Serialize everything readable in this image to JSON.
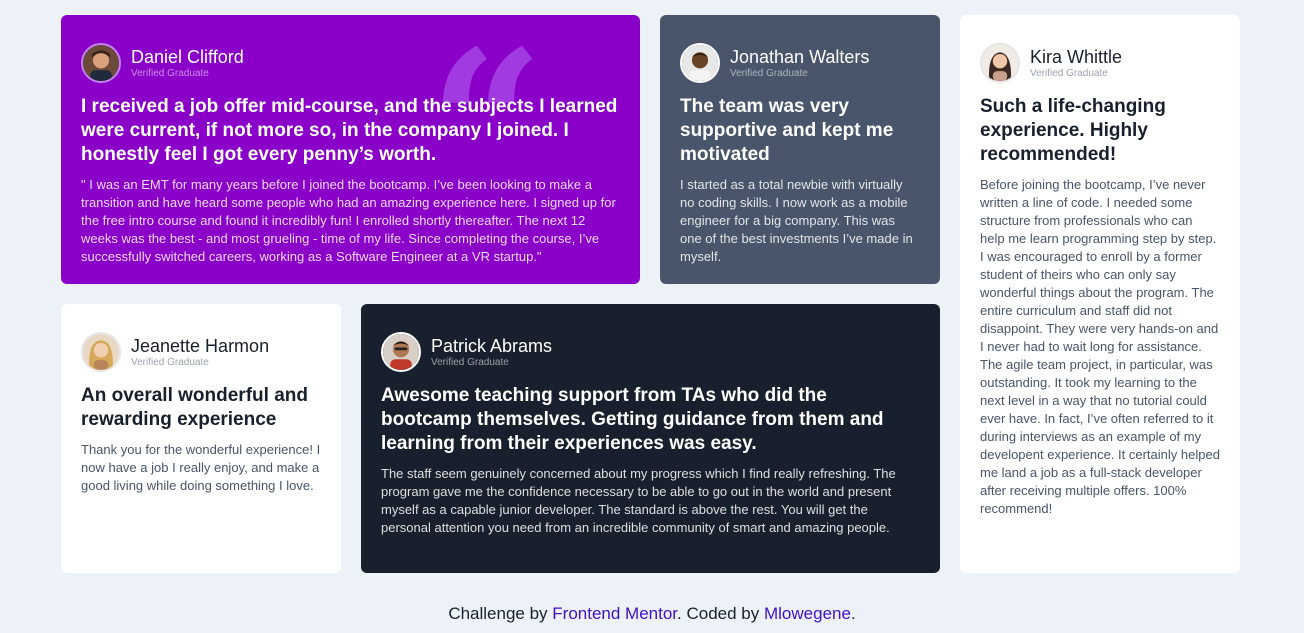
{
  "testimonials": [
    {
      "name": "Daniel Clifford",
      "role": "Verified Graduate",
      "headline": "I received a job offer mid-course, and the subjects I learned were current, if not more so, in the company I joined. I honestly feel I got every penny’s worth.",
      "body": "\" I was an EMT for many years before I joined the bootcamp. I’ve been looking to make a transition and have heard some people who had an amazing experience here. I signed up for the free intro course and found it incredibly fun! I enrolled shortly thereafter. The next 12 weeks was the best - and most grueling - time of my life. Since completing the course, I’ve successfully switched careers, working as a Software Engineer at a VR startup.\""
    },
    {
      "name": "Jonathan Walters",
      "role": "Verified Graduate",
      "headline": "The team was very supportive and kept me motivated",
      "body": "I started as a total newbie with virtually no coding skills. I now work as a mobile engineer for a big company. This was one of the best investments I’ve made in myself."
    },
    {
      "name": "Kira Whittle",
      "role": "Verified Graduate",
      "headline": "Such a life-changing experience. Highly recommended!",
      "body": "Before joining the bootcamp, I’ve never written a line of code. I needed some structure from professionals who can help me learn programming step by step. I was encouraged to enroll by a former student of theirs who can only say wonderful things about the program. The entire curriculum and staff did not disappoint. They were very hands-on and I never had to wait long for assistance. The agile team project, in particular, was outstanding. It took my learning to the next level in a way that no tutorial could ever have. In fact, I’ve often referred to it during interviews as an example of my developent experience. It certainly helped me land a job as a full-stack developer after receiving multiple offers. 100% recommend!"
    },
    {
      "name": "Jeanette Harmon",
      "role": "Verified Graduate",
      "headline": "An overall wonderful and rewarding experience",
      "body": "Thank you for the wonderful experience! I now have a job I really enjoy, and make a good living while doing something I love."
    },
    {
      "name": "Patrick Abrams",
      "role": "Verified Graduate",
      "headline": "Awesome teaching support from TAs who did the bootcamp themselves. Getting guidance from them and learning from their experiences was easy.",
      "body": "The staff seem genuinely concerned about my progress which I find really refreshing. The program gave me the confidence necessary to be able to go out in the world and present myself as a capable junior developer. The standard is above the rest. You will get the personal attention you need from an incredible community of smart and amazing people."
    }
  ],
  "footer": {
    "prefix": "Challenge by ",
    "link1": "Frontend Mentor",
    "middle": ". Coded by ",
    "link2": "Mlowegene",
    "suffix": "."
  },
  "colors": {
    "purple": "#8a00c9",
    "slate": "#48556a",
    "dark": "#19202d",
    "background": "#ecf2f8",
    "link": "#3f10c7"
  }
}
